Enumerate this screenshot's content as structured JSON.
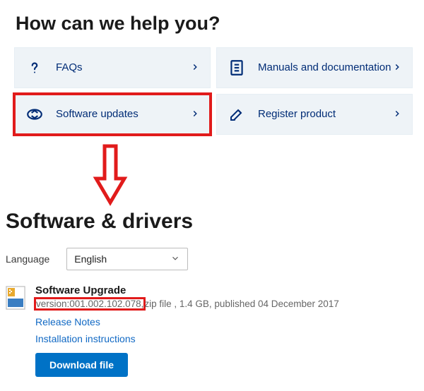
{
  "help": {
    "heading": "How can we help you?",
    "cards": [
      {
        "label": "FAQs"
      },
      {
        "label": "Manuals and documentation"
      },
      {
        "label": "Software updates"
      },
      {
        "label": "Register product"
      }
    ]
  },
  "drivers": {
    "heading": "Software & drivers",
    "language_label": "Language",
    "language_value": "English",
    "item": {
      "title": "Software Upgrade",
      "version_text": "version:001.002.102.078,",
      "meta_rest": "zip file , 1.4 GB, published 04 December 2017",
      "link_release_notes": "Release Notes",
      "link_install": "Installation instructions",
      "button": "Download file"
    }
  }
}
